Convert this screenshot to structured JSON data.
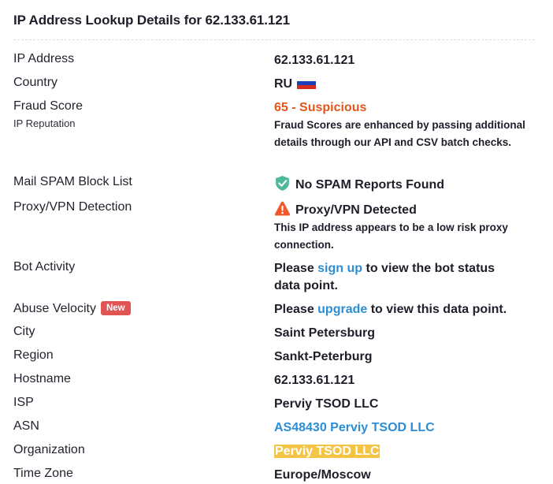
{
  "title": "IP Address Lookup Details for 62.133.61.121",
  "rows": {
    "ip": {
      "label": "IP Address",
      "value": "62.133.61.121"
    },
    "country": {
      "label": "Country",
      "value": "RU",
      "flag": "russian-flag"
    },
    "fraud": {
      "label": "Fraud Score",
      "sublabel": "IP Reputation",
      "value": "65 - Suspicious",
      "note": "Fraud Scores are enhanced by passing additional details through our API and CSV batch checks.",
      "color": "#e2561c"
    },
    "spam": {
      "label": "Mail SPAM Block List",
      "value": "No SPAM Reports Found",
      "icon": "shield-check-icon",
      "icon_color": "#4fb89a"
    },
    "proxy": {
      "label": "Proxy/VPN Detection",
      "value": "Proxy/VPN Detected",
      "icon": "warning-icon",
      "icon_color": "#f0572b",
      "note": "This IP address appears to be a low risk proxy connection."
    },
    "bot": {
      "label": "Bot Activity",
      "prefix": "Please ",
      "link": "sign up",
      "suffix": " to view the bot status data point."
    },
    "abuse": {
      "label": "Abuse Velocity",
      "badge": "New",
      "prefix": "Please ",
      "link": "upgrade",
      "suffix": " to view this data point."
    },
    "city": {
      "label": "City",
      "value": "Saint Petersburg"
    },
    "region": {
      "label": "Region",
      "value": "Sankt-Peterburg"
    },
    "hostname": {
      "label": "Hostname",
      "value": "62.133.61.121"
    },
    "isp": {
      "label": "ISP",
      "value": "Perviy TSOD LLC"
    },
    "asn": {
      "label": "ASN",
      "value": "AS48430 Perviy TSOD LLC"
    },
    "org": {
      "label": "Organization",
      "value": "Perviy TSOD LLC",
      "highlight_color": "#f5c445"
    },
    "timezone": {
      "label": "Time Zone",
      "value": "Europe/Moscow"
    }
  },
  "colors": {
    "link": "#2b8ed4",
    "badge": "#e05454"
  }
}
